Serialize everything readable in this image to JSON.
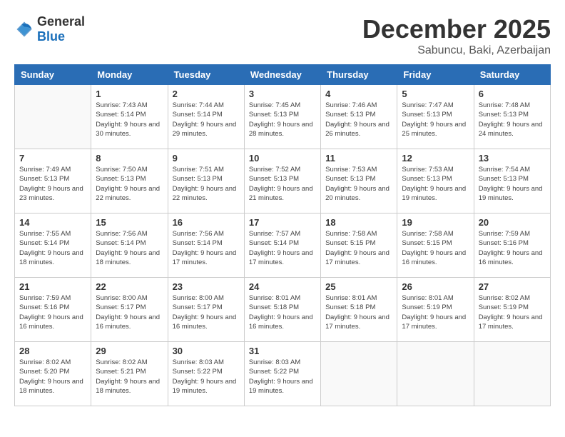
{
  "logo": {
    "text_general": "General",
    "text_blue": "Blue"
  },
  "title": {
    "month": "December 2025",
    "location": "Sabuncu, Baki, Azerbaijan"
  },
  "days": [
    "Sunday",
    "Monday",
    "Tuesday",
    "Wednesday",
    "Thursday",
    "Friday",
    "Saturday"
  ],
  "weeks": [
    [
      {
        "date": "",
        "sunrise": "",
        "sunset": "",
        "daylight": ""
      },
      {
        "date": "1",
        "sunrise": "Sunrise: 7:43 AM",
        "sunset": "Sunset: 5:14 PM",
        "daylight": "Daylight: 9 hours and 30 minutes."
      },
      {
        "date": "2",
        "sunrise": "Sunrise: 7:44 AM",
        "sunset": "Sunset: 5:14 PM",
        "daylight": "Daylight: 9 hours and 29 minutes."
      },
      {
        "date": "3",
        "sunrise": "Sunrise: 7:45 AM",
        "sunset": "Sunset: 5:13 PM",
        "daylight": "Daylight: 9 hours and 28 minutes."
      },
      {
        "date": "4",
        "sunrise": "Sunrise: 7:46 AM",
        "sunset": "Sunset: 5:13 PM",
        "daylight": "Daylight: 9 hours and 26 minutes."
      },
      {
        "date": "5",
        "sunrise": "Sunrise: 7:47 AM",
        "sunset": "Sunset: 5:13 PM",
        "daylight": "Daylight: 9 hours and 25 minutes."
      },
      {
        "date": "6",
        "sunrise": "Sunrise: 7:48 AM",
        "sunset": "Sunset: 5:13 PM",
        "daylight": "Daylight: 9 hours and 24 minutes."
      }
    ],
    [
      {
        "date": "7",
        "sunrise": "Sunrise: 7:49 AM",
        "sunset": "Sunset: 5:13 PM",
        "daylight": "Daylight: 9 hours and 23 minutes."
      },
      {
        "date": "8",
        "sunrise": "Sunrise: 7:50 AM",
        "sunset": "Sunset: 5:13 PM",
        "daylight": "Daylight: 9 hours and 22 minutes."
      },
      {
        "date": "9",
        "sunrise": "Sunrise: 7:51 AM",
        "sunset": "Sunset: 5:13 PM",
        "daylight": "Daylight: 9 hours and 22 minutes."
      },
      {
        "date": "10",
        "sunrise": "Sunrise: 7:52 AM",
        "sunset": "Sunset: 5:13 PM",
        "daylight": "Daylight: 9 hours and 21 minutes."
      },
      {
        "date": "11",
        "sunrise": "Sunrise: 7:53 AM",
        "sunset": "Sunset: 5:13 PM",
        "daylight": "Daylight: 9 hours and 20 minutes."
      },
      {
        "date": "12",
        "sunrise": "Sunrise: 7:53 AM",
        "sunset": "Sunset: 5:13 PM",
        "daylight": "Daylight: 9 hours and 19 minutes."
      },
      {
        "date": "13",
        "sunrise": "Sunrise: 7:54 AM",
        "sunset": "Sunset: 5:13 PM",
        "daylight": "Daylight: 9 hours and 19 minutes."
      }
    ],
    [
      {
        "date": "14",
        "sunrise": "Sunrise: 7:55 AM",
        "sunset": "Sunset: 5:14 PM",
        "daylight": "Daylight: 9 hours and 18 minutes."
      },
      {
        "date": "15",
        "sunrise": "Sunrise: 7:56 AM",
        "sunset": "Sunset: 5:14 PM",
        "daylight": "Daylight: 9 hours and 18 minutes."
      },
      {
        "date": "16",
        "sunrise": "Sunrise: 7:56 AM",
        "sunset": "Sunset: 5:14 PM",
        "daylight": "Daylight: 9 hours and 17 minutes."
      },
      {
        "date": "17",
        "sunrise": "Sunrise: 7:57 AM",
        "sunset": "Sunset: 5:14 PM",
        "daylight": "Daylight: 9 hours and 17 minutes."
      },
      {
        "date": "18",
        "sunrise": "Sunrise: 7:58 AM",
        "sunset": "Sunset: 5:15 PM",
        "daylight": "Daylight: 9 hours and 17 minutes."
      },
      {
        "date": "19",
        "sunrise": "Sunrise: 7:58 AM",
        "sunset": "Sunset: 5:15 PM",
        "daylight": "Daylight: 9 hours and 16 minutes."
      },
      {
        "date": "20",
        "sunrise": "Sunrise: 7:59 AM",
        "sunset": "Sunset: 5:16 PM",
        "daylight": "Daylight: 9 hours and 16 minutes."
      }
    ],
    [
      {
        "date": "21",
        "sunrise": "Sunrise: 7:59 AM",
        "sunset": "Sunset: 5:16 PM",
        "daylight": "Daylight: 9 hours and 16 minutes."
      },
      {
        "date": "22",
        "sunrise": "Sunrise: 8:00 AM",
        "sunset": "Sunset: 5:17 PM",
        "daylight": "Daylight: 9 hours and 16 minutes."
      },
      {
        "date": "23",
        "sunrise": "Sunrise: 8:00 AM",
        "sunset": "Sunset: 5:17 PM",
        "daylight": "Daylight: 9 hours and 16 minutes."
      },
      {
        "date": "24",
        "sunrise": "Sunrise: 8:01 AM",
        "sunset": "Sunset: 5:18 PM",
        "daylight": "Daylight: 9 hours and 16 minutes."
      },
      {
        "date": "25",
        "sunrise": "Sunrise: 8:01 AM",
        "sunset": "Sunset: 5:18 PM",
        "daylight": "Daylight: 9 hours and 17 minutes."
      },
      {
        "date": "26",
        "sunrise": "Sunrise: 8:01 AM",
        "sunset": "Sunset: 5:19 PM",
        "daylight": "Daylight: 9 hours and 17 minutes."
      },
      {
        "date": "27",
        "sunrise": "Sunrise: 8:02 AM",
        "sunset": "Sunset: 5:19 PM",
        "daylight": "Daylight: 9 hours and 17 minutes."
      }
    ],
    [
      {
        "date": "28",
        "sunrise": "Sunrise: 8:02 AM",
        "sunset": "Sunset: 5:20 PM",
        "daylight": "Daylight: 9 hours and 18 minutes."
      },
      {
        "date": "29",
        "sunrise": "Sunrise: 8:02 AM",
        "sunset": "Sunset: 5:21 PM",
        "daylight": "Daylight: 9 hours and 18 minutes."
      },
      {
        "date": "30",
        "sunrise": "Sunrise: 8:03 AM",
        "sunset": "Sunset: 5:22 PM",
        "daylight": "Daylight: 9 hours and 19 minutes."
      },
      {
        "date": "31",
        "sunrise": "Sunrise: 8:03 AM",
        "sunset": "Sunset: 5:22 PM",
        "daylight": "Daylight: 9 hours and 19 minutes."
      },
      {
        "date": "",
        "sunrise": "",
        "sunset": "",
        "daylight": ""
      },
      {
        "date": "",
        "sunrise": "",
        "sunset": "",
        "daylight": ""
      },
      {
        "date": "",
        "sunrise": "",
        "sunset": "",
        "daylight": ""
      }
    ]
  ]
}
